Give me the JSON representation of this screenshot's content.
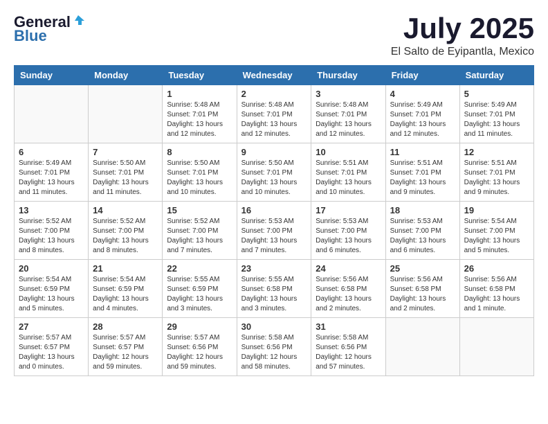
{
  "logo": {
    "general": "General",
    "blue": "Blue"
  },
  "title": "July 2025",
  "location": "El Salto de Eyipantla, Mexico",
  "days_of_week": [
    "Sunday",
    "Monday",
    "Tuesday",
    "Wednesday",
    "Thursday",
    "Friday",
    "Saturday"
  ],
  "weeks": [
    [
      {
        "day": "",
        "info": ""
      },
      {
        "day": "",
        "info": ""
      },
      {
        "day": "1",
        "info": "Sunrise: 5:48 AM\nSunset: 7:01 PM\nDaylight: 13 hours and 12 minutes."
      },
      {
        "day": "2",
        "info": "Sunrise: 5:48 AM\nSunset: 7:01 PM\nDaylight: 13 hours and 12 minutes."
      },
      {
        "day": "3",
        "info": "Sunrise: 5:48 AM\nSunset: 7:01 PM\nDaylight: 13 hours and 12 minutes."
      },
      {
        "day": "4",
        "info": "Sunrise: 5:49 AM\nSunset: 7:01 PM\nDaylight: 13 hours and 12 minutes."
      },
      {
        "day": "5",
        "info": "Sunrise: 5:49 AM\nSunset: 7:01 PM\nDaylight: 13 hours and 11 minutes."
      }
    ],
    [
      {
        "day": "6",
        "info": "Sunrise: 5:49 AM\nSunset: 7:01 PM\nDaylight: 13 hours and 11 minutes."
      },
      {
        "day": "7",
        "info": "Sunrise: 5:50 AM\nSunset: 7:01 PM\nDaylight: 13 hours and 11 minutes."
      },
      {
        "day": "8",
        "info": "Sunrise: 5:50 AM\nSunset: 7:01 PM\nDaylight: 13 hours and 10 minutes."
      },
      {
        "day": "9",
        "info": "Sunrise: 5:50 AM\nSunset: 7:01 PM\nDaylight: 13 hours and 10 minutes."
      },
      {
        "day": "10",
        "info": "Sunrise: 5:51 AM\nSunset: 7:01 PM\nDaylight: 13 hours and 10 minutes."
      },
      {
        "day": "11",
        "info": "Sunrise: 5:51 AM\nSunset: 7:01 PM\nDaylight: 13 hours and 9 minutes."
      },
      {
        "day": "12",
        "info": "Sunrise: 5:51 AM\nSunset: 7:01 PM\nDaylight: 13 hours and 9 minutes."
      }
    ],
    [
      {
        "day": "13",
        "info": "Sunrise: 5:52 AM\nSunset: 7:00 PM\nDaylight: 13 hours and 8 minutes."
      },
      {
        "day": "14",
        "info": "Sunrise: 5:52 AM\nSunset: 7:00 PM\nDaylight: 13 hours and 8 minutes."
      },
      {
        "day": "15",
        "info": "Sunrise: 5:52 AM\nSunset: 7:00 PM\nDaylight: 13 hours and 7 minutes."
      },
      {
        "day": "16",
        "info": "Sunrise: 5:53 AM\nSunset: 7:00 PM\nDaylight: 13 hours and 7 minutes."
      },
      {
        "day": "17",
        "info": "Sunrise: 5:53 AM\nSunset: 7:00 PM\nDaylight: 13 hours and 6 minutes."
      },
      {
        "day": "18",
        "info": "Sunrise: 5:53 AM\nSunset: 7:00 PM\nDaylight: 13 hours and 6 minutes."
      },
      {
        "day": "19",
        "info": "Sunrise: 5:54 AM\nSunset: 7:00 PM\nDaylight: 13 hours and 5 minutes."
      }
    ],
    [
      {
        "day": "20",
        "info": "Sunrise: 5:54 AM\nSunset: 6:59 PM\nDaylight: 13 hours and 5 minutes."
      },
      {
        "day": "21",
        "info": "Sunrise: 5:54 AM\nSunset: 6:59 PM\nDaylight: 13 hours and 4 minutes."
      },
      {
        "day": "22",
        "info": "Sunrise: 5:55 AM\nSunset: 6:59 PM\nDaylight: 13 hours and 3 minutes."
      },
      {
        "day": "23",
        "info": "Sunrise: 5:55 AM\nSunset: 6:58 PM\nDaylight: 13 hours and 3 minutes."
      },
      {
        "day": "24",
        "info": "Sunrise: 5:56 AM\nSunset: 6:58 PM\nDaylight: 13 hours and 2 minutes."
      },
      {
        "day": "25",
        "info": "Sunrise: 5:56 AM\nSunset: 6:58 PM\nDaylight: 13 hours and 2 minutes."
      },
      {
        "day": "26",
        "info": "Sunrise: 5:56 AM\nSunset: 6:58 PM\nDaylight: 13 hours and 1 minute."
      }
    ],
    [
      {
        "day": "27",
        "info": "Sunrise: 5:57 AM\nSunset: 6:57 PM\nDaylight: 13 hours and 0 minutes."
      },
      {
        "day": "28",
        "info": "Sunrise: 5:57 AM\nSunset: 6:57 PM\nDaylight: 12 hours and 59 minutes."
      },
      {
        "day": "29",
        "info": "Sunrise: 5:57 AM\nSunset: 6:56 PM\nDaylight: 12 hours and 59 minutes."
      },
      {
        "day": "30",
        "info": "Sunrise: 5:58 AM\nSunset: 6:56 PM\nDaylight: 12 hours and 58 minutes."
      },
      {
        "day": "31",
        "info": "Sunrise: 5:58 AM\nSunset: 6:56 PM\nDaylight: 12 hours and 57 minutes."
      },
      {
        "day": "",
        "info": ""
      },
      {
        "day": "",
        "info": ""
      }
    ]
  ]
}
